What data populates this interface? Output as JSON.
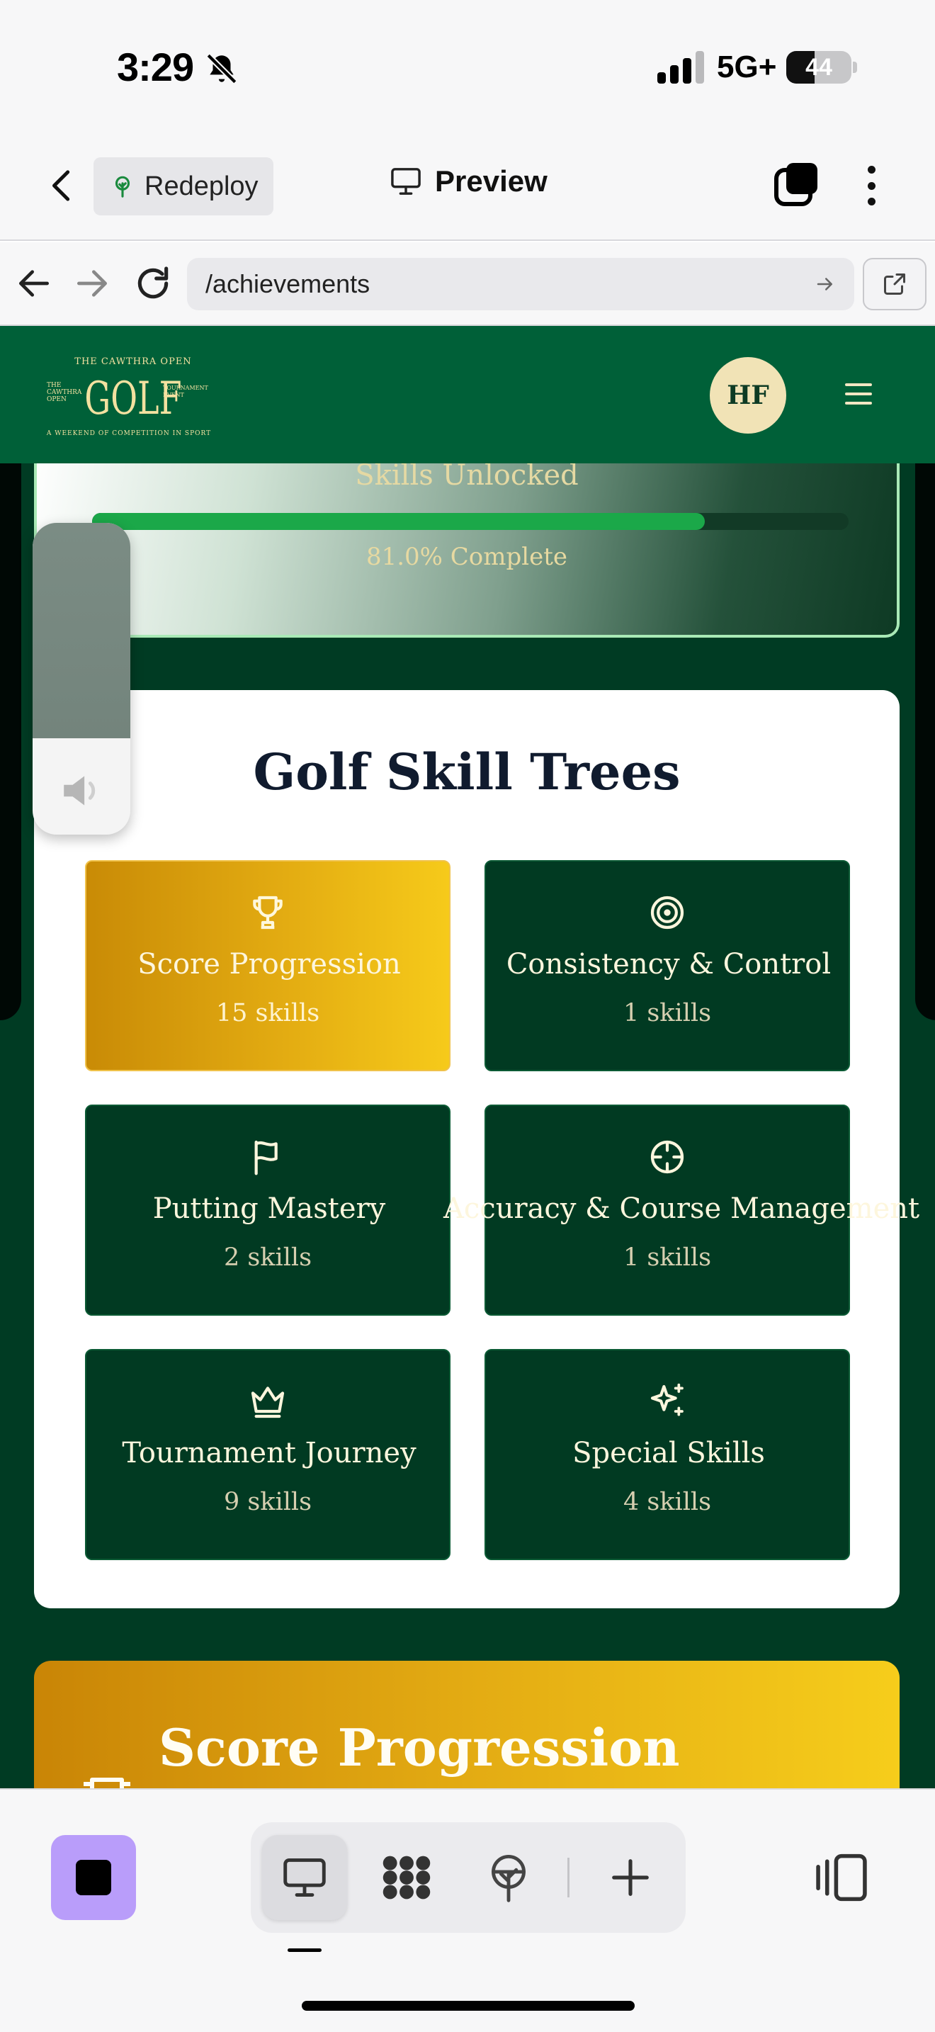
{
  "status_bar": {
    "time": "3:29",
    "network": "5G+",
    "battery": "44",
    "battery_level": 0.44
  },
  "toolbar": {
    "redeploy_label": "Redeploy",
    "preview_label": "Preview"
  },
  "address_bar": {
    "url": "/achievements"
  },
  "site_header": {
    "logo_text": "THE CAWTHRA OPEN GOLF TOURNAMENT EVENT — A WEEKEND OF COMPETITION IN SPORT",
    "avatar_initials": "HF"
  },
  "progress": {
    "heading": "Skills Unlocked",
    "percent": 81.0,
    "label": "81.0% Complete"
  },
  "skill_trees": {
    "title": "Golf Skill Trees",
    "items": [
      {
        "label": "Score Progression",
        "count": "15 skills",
        "icon": "trophy-icon",
        "active": true
      },
      {
        "label": "Consistency & Control",
        "count": "1 skills",
        "icon": "target-icon",
        "active": false
      },
      {
        "label": "Putting Mastery",
        "count": "2 skills",
        "icon": "flag-icon",
        "active": false
      },
      {
        "label": "Accuracy & Course Management",
        "count": "1 skills",
        "icon": "crosshair-icon",
        "active": false
      },
      {
        "label": "Tournament Journey",
        "count": "9 skills",
        "icon": "crown-icon",
        "active": false
      },
      {
        "label": "Special Skills",
        "count": "4 skills",
        "icon": "sparkles-icon",
        "active": false
      }
    ]
  },
  "score_section": {
    "title": "Score Progression"
  },
  "colors": {
    "site_green": "#006038",
    "panel_dark": "#013a22",
    "gold": "#e3ac12",
    "accent_purple": "#b99dfa"
  }
}
